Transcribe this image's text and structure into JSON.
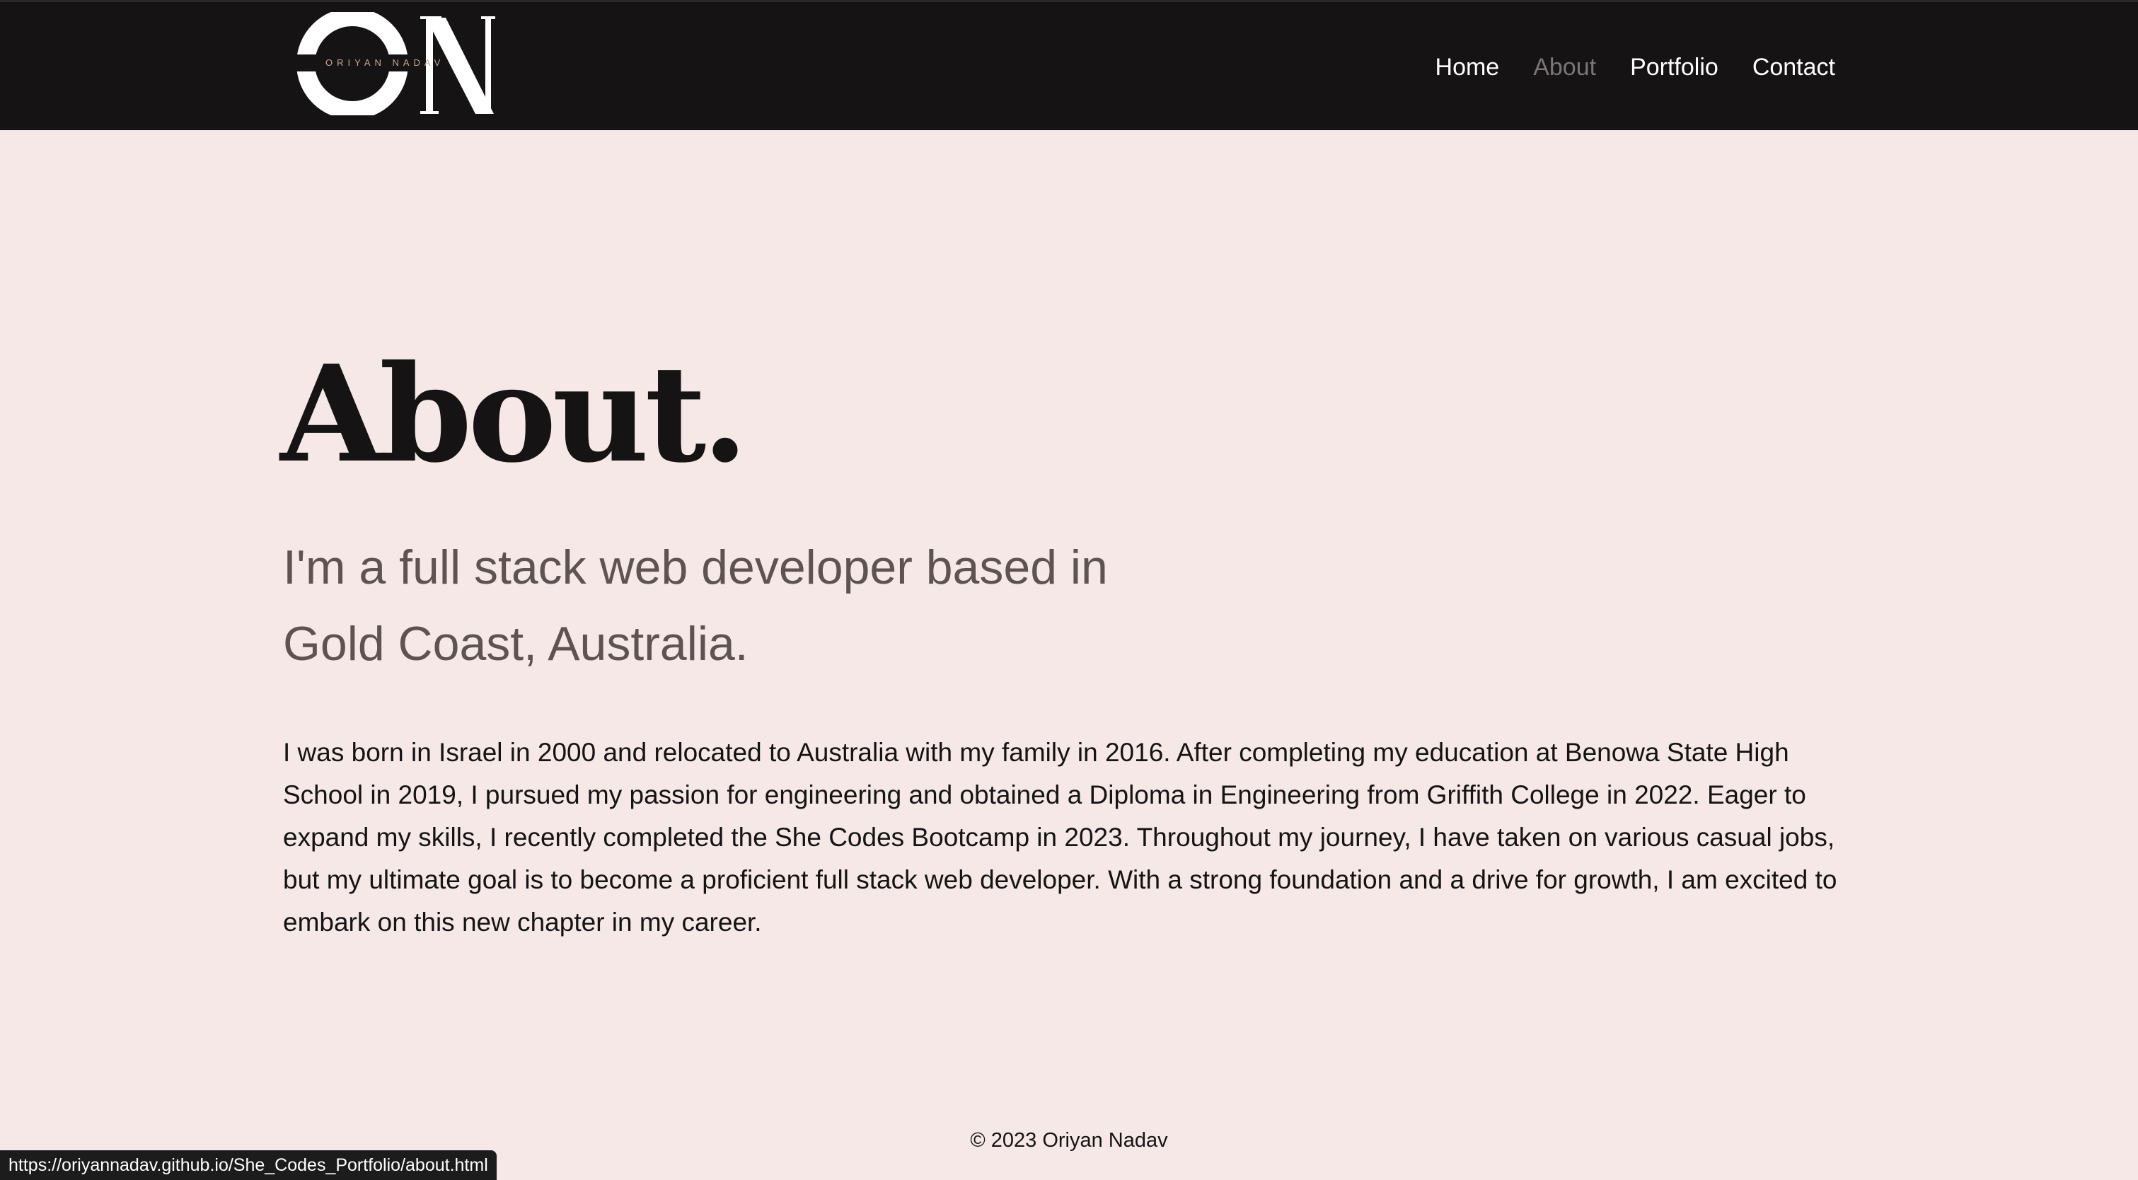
{
  "header": {
    "logo": {
      "monogram": "ON",
      "name": "ORIYAN NADAV"
    },
    "nav": [
      {
        "label": "Home",
        "active": false
      },
      {
        "label": "About",
        "active": true
      },
      {
        "label": "Portfolio",
        "active": false
      },
      {
        "label": "Contact",
        "active": false
      }
    ]
  },
  "main": {
    "heading": "About.",
    "subtitle": "I'm a full stack web developer based in Gold Coast, Australia.",
    "bio": "I was born in Israel in 2000 and relocated to Australia with my family in 2016. After completing my education at Benowa State High School in 2019, I pursued my passion for engineering and obtained a Diploma in Engineering from Griffith College in 2022. Eager to expand my skills, I recently completed the She Codes Bootcamp in 2023. Throughout my journey, I have taken on various casual jobs, but my ultimate goal is to become a proficient full stack web developer. With a strong foundation and a drive for growth, I am excited to embark on this new chapter in my career."
  },
  "footer": {
    "copyright": "© 2023 Oriyan Nadav"
  },
  "browser": {
    "status_url": "https://oriyannadav.github.io/She_Codes_Portfolio/about.html"
  },
  "colors": {
    "background": "#f5e8e7",
    "navbar": "#151313",
    "nav_active": "#7b7676",
    "subtitle": "#5e5252",
    "logo_text_accent": "#c9a7a0"
  }
}
